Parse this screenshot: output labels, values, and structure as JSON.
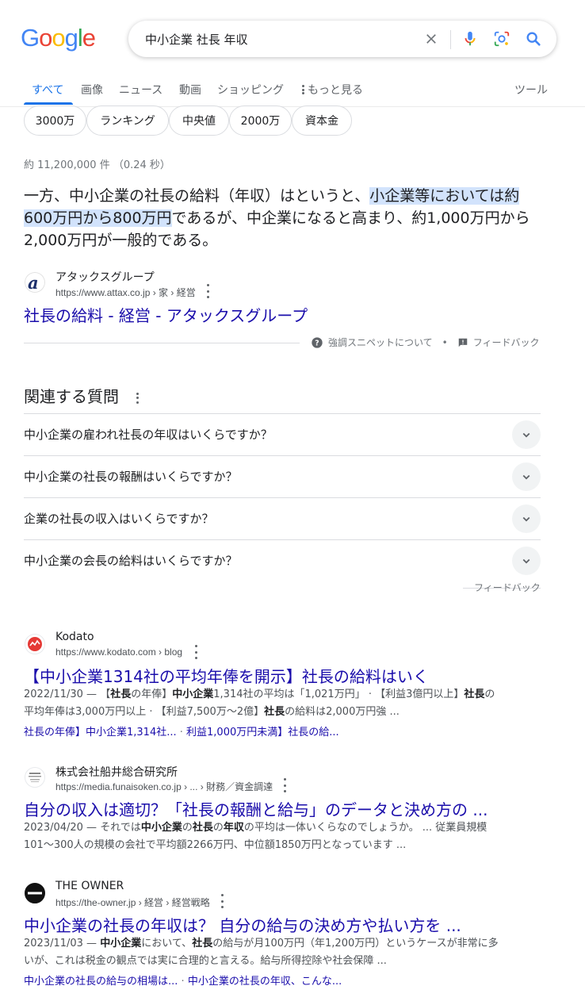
{
  "header": {
    "logo_letters": [
      "G",
      "o",
      "o",
      "g",
      "l",
      "e"
    ],
    "logo_colors": [
      "#4285F4",
      "#EA4335",
      "#FBBC05",
      "#4285F4",
      "#34A853",
      "#EA4335"
    ],
    "query": "中小企業 社長 年収"
  },
  "tabs": [
    {
      "label": "すべて",
      "active": true
    },
    {
      "label": "画像"
    },
    {
      "label": "ニュース"
    },
    {
      "label": "動画"
    },
    {
      "label": "ショッピング"
    },
    {
      "label": "もっと見る"
    },
    {
      "label": "ツール"
    }
  ],
  "chips": [
    "3000万",
    "ランキング",
    "中央値",
    "2000万",
    "資本金"
  ],
  "stats": "約 11,200,000 件 （0.24 秒）",
  "featured": {
    "text_before": "一方、中小企業の社長の給料（年収）はというと、",
    "text_highlight": "小企業等においては約600万円から800万円",
    "text_after": "であるが、中企業になると高まり、約1,000万円から2,000万円が一般的である。",
    "site": "アタックスグループ",
    "url": "https://www.attax.co.jp › 家 › 経営",
    "title": "社長の給料 - 経営 - アタックスグループ",
    "about_label": "強調スニペットについて",
    "bullet": "•",
    "feedback_label": "フィードバック"
  },
  "paa": {
    "title": "関連する質問",
    "questions": [
      "中小企業の雇われ社長の年収はいくらですか？",
      "中小企業の社長の報酬はいくらですか？",
      "企業の社長の収入はいくらですか？",
      "中小企業の会長の給料はいくらですか？"
    ],
    "feedback_label": "フィードバック"
  },
  "results": [
    {
      "site": "Kodato",
      "url": "https://www.kodato.com › blog",
      "title": "【中小企業1314社の平均年俸を開示】社長の給料はいく",
      "date": "2022/11/30 — ",
      "snippet_parts": [
        {
          "t": "【"
        },
        {
          "t": "社長",
          "b": true
        },
        {
          "t": "の年俸】"
        },
        {
          "t": "中小企業",
          "b": true
        },
        {
          "t": "1,314社の平均は「1,021万円」 · 【利益3億円以上】"
        },
        {
          "t": "社長",
          "b": true
        },
        {
          "t": "の平均年俸は3,000万円以上 · 【利益7,500万〜2億】"
        },
        {
          "t": "社長",
          "b": true
        },
        {
          "t": "の給料は2,000万円強 ..."
        }
      ],
      "sublinks": [
        "社長の年俸】中小企業1,314社...",
        "利益1,000万円未満】社長の給..."
      ],
      "sublink_sep": " · "
    },
    {
      "site": "株式会社船井総合研究所",
      "url": "https://media.funaisoken.co.jp › ... › 財務／資金調達",
      "title": "自分の収入は適切？「社長の報酬と給与」のデータと決め方の ...",
      "date": "2023/04/20 — ",
      "snippet_parts": [
        {
          "t": "それでは"
        },
        {
          "t": "中小企業",
          "b": true
        },
        {
          "t": "の"
        },
        {
          "t": "社長",
          "b": true
        },
        {
          "t": "の"
        },
        {
          "t": "年収",
          "b": true
        },
        {
          "t": "の平均は一体いくらなのでしょうか。 ... 従業員規模101〜300人の規模の会社で平均額2266万円、中位額1850万円となっています ..."
        }
      ],
      "sublinks": []
    },
    {
      "site": "THE OWNER",
      "url": "https://the-owner.jp › 経営 › 経営戦略",
      "title": "中小企業の社長の年収は？ 自分の給与の決め方や払い方を ...",
      "date": "2023/11/03 — ",
      "snippet_parts": [
        {
          "t": "中小企業",
          "b": true
        },
        {
          "t": "において、"
        },
        {
          "t": "社長",
          "b": true
        },
        {
          "t": "の給与が月100万円（年1,200万円）というケースが非常に多いが、これは税金の観点では実に合理的と言える。給与所得控除や社会保障 ..."
        }
      ],
      "sublinks": [
        "中小企業の社長の給与の相場は...",
        "中小企業の社長の年収、こんな..."
      ],
      "sublink_sep": " · "
    }
  ],
  "colors": {
    "link": "#1a0dab",
    "accent": "#1a73e8",
    "highlight": "#d2e3fc"
  }
}
